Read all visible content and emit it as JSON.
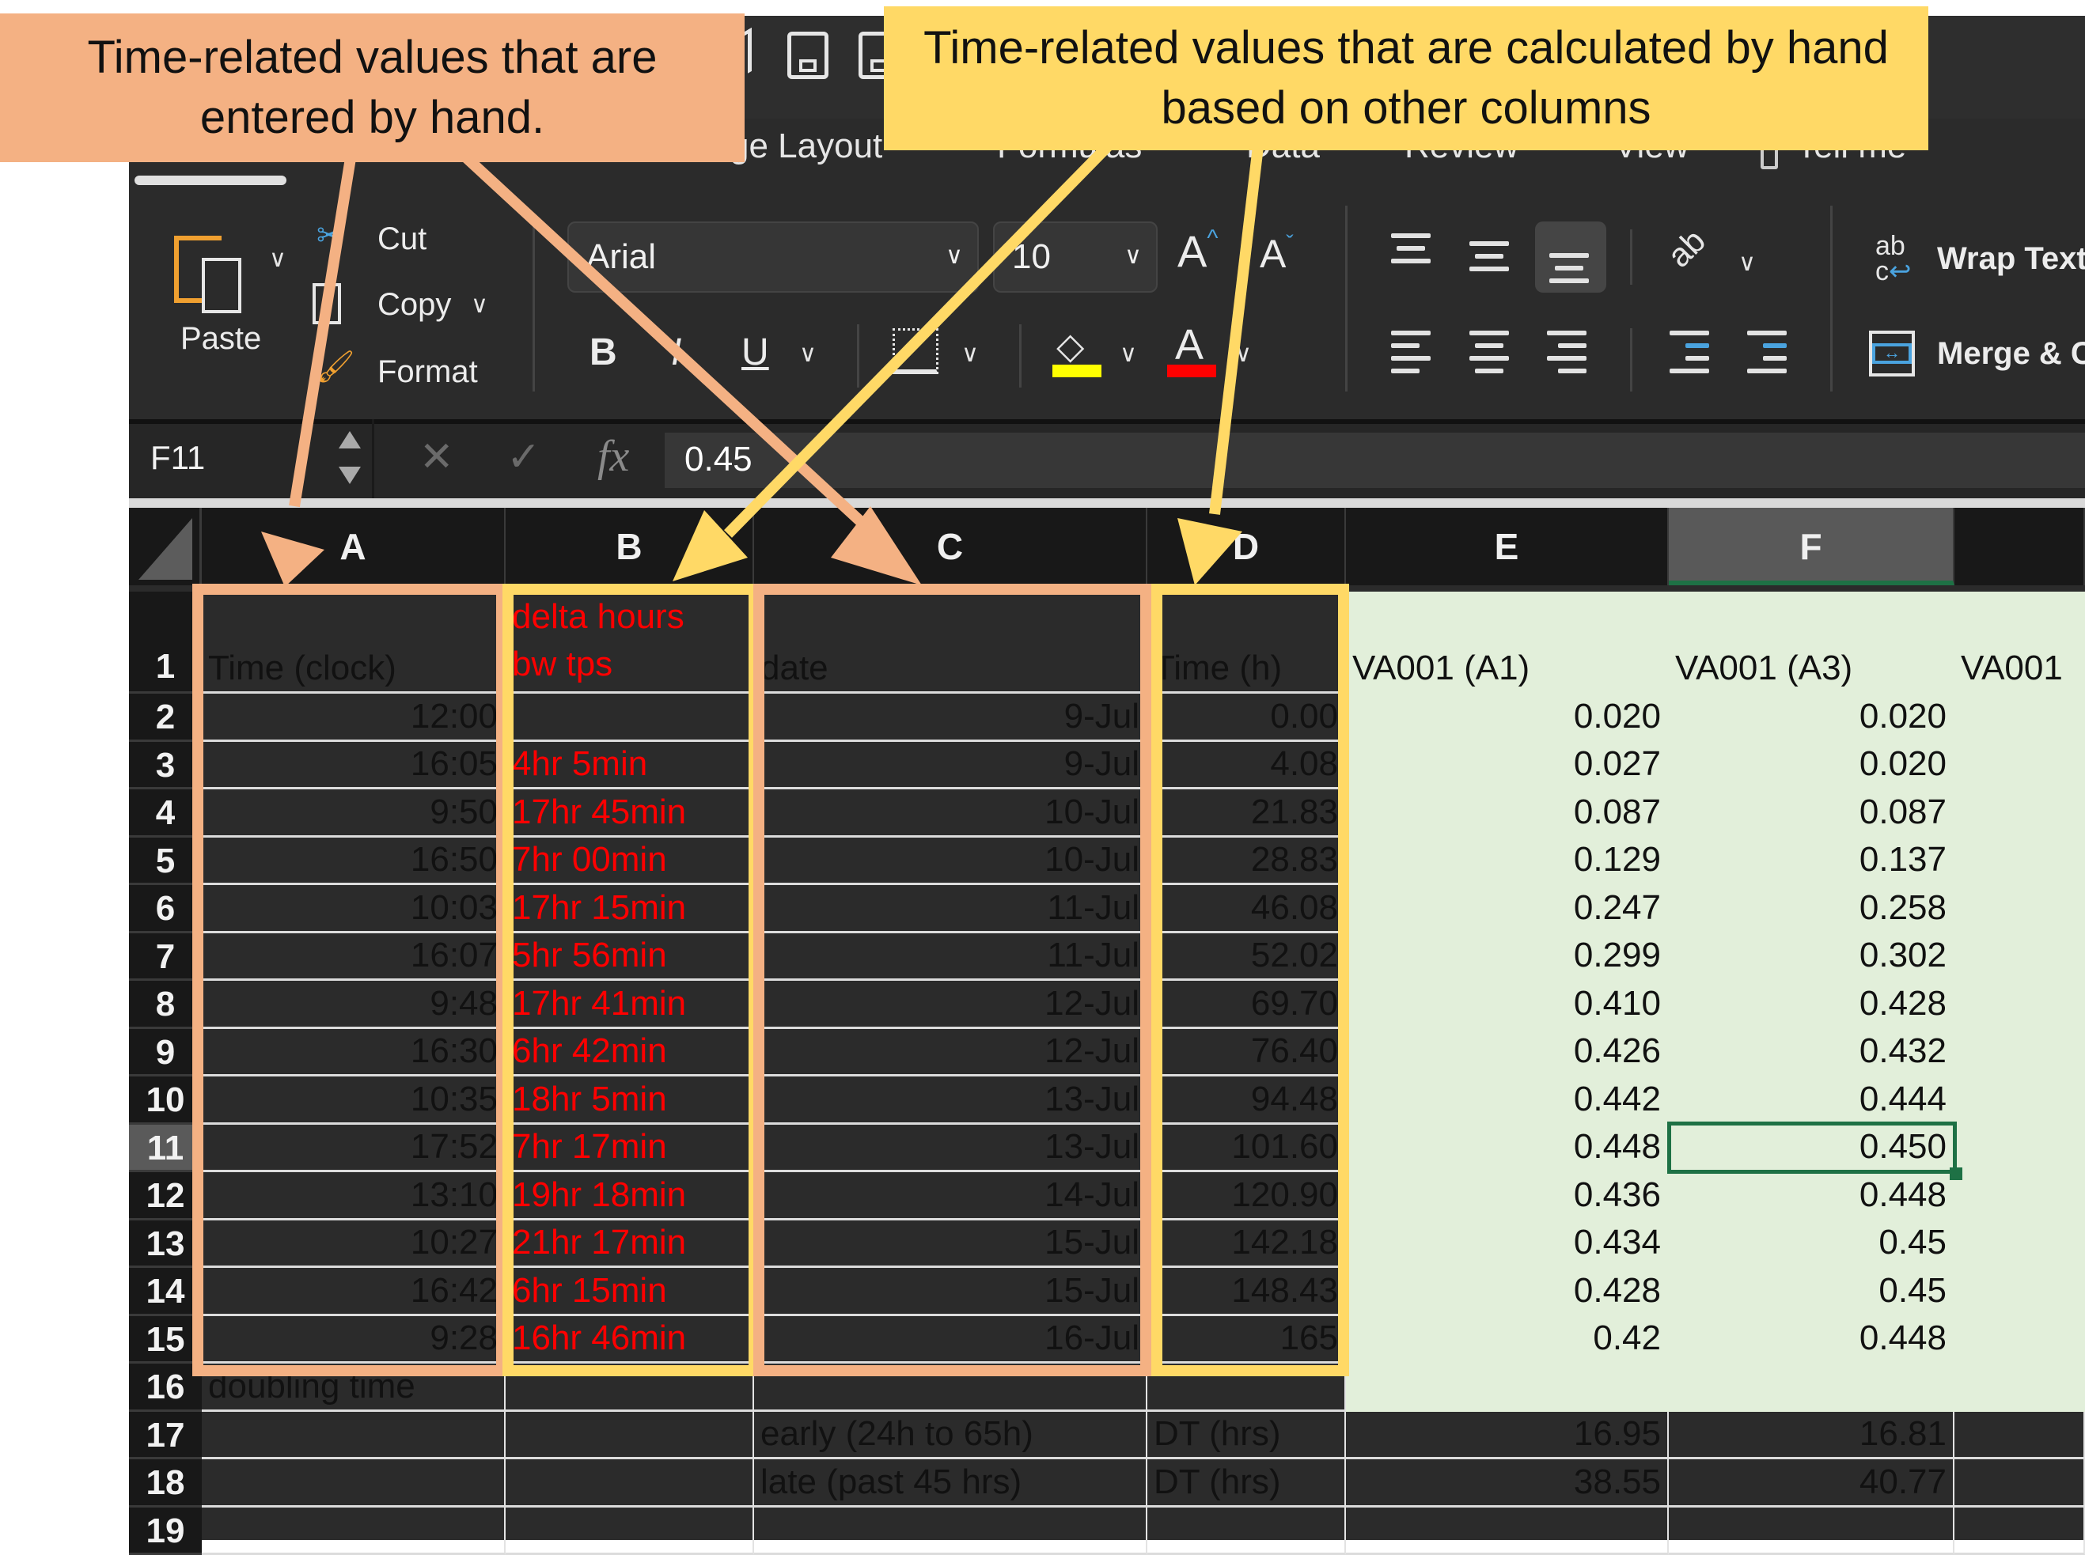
{
  "callouts": {
    "manual": "Time-related values that are entered by hand.",
    "calculated": "Time-related values that are calculated by hand based on other columns"
  },
  "colors": {
    "manual_highlight": "#f4b183",
    "calculated_highlight": "#ffd966",
    "selection": "#1e7145",
    "data_fill": "#e2efda",
    "red_text": "#ff0000"
  },
  "tabs": [
    "ge Layout",
    "Formulas",
    "Data",
    "Review",
    "View",
    "Tell me"
  ],
  "ribbon": {
    "clipboard": {
      "paste": "Paste",
      "cut": "Cut",
      "copy": "Copy",
      "format": "Format"
    },
    "font": {
      "name": "Arial",
      "size": "10",
      "bold": "B",
      "italic": "I",
      "underline": "U",
      "increase": "A",
      "decrease": "A",
      "font_color": "A"
    },
    "wrap_text": "Wrap Text",
    "merge": "Merge & C"
  },
  "formula_bar": {
    "name_box": "F11",
    "fx": "fx",
    "value": "0.45"
  },
  "columns": [
    "A",
    "B",
    "C",
    "D",
    "E",
    "F",
    ""
  ],
  "selected_column": "F",
  "selected_row": "11",
  "rows": [
    {
      "n": "1",
      "A": "Time (clock)",
      "B": "delta hours\nbw tps",
      "C": "date",
      "D": "Time (h)",
      "E": "VA001 (A1)",
      "F": "VA001 (A3)",
      "G": "VA001"
    },
    {
      "n": "2",
      "A": "12:00",
      "B": "",
      "C": "9-Jul",
      "D": "0.00",
      "E": "0.020",
      "F": "0.020"
    },
    {
      "n": "3",
      "A": "16:05",
      "B": "4hr 5min",
      "C": "9-Jul",
      "D": "4.08",
      "E": "0.027",
      "F": "0.020"
    },
    {
      "n": "4",
      "A": "9:50",
      "B": "17hr 45min",
      "C": "10-Jul",
      "D": "21.83",
      "E": "0.087",
      "F": "0.087"
    },
    {
      "n": "5",
      "A": "16:50",
      "B": "7hr 00min",
      "C": "10-Jul",
      "D": "28.83",
      "E": "0.129",
      "F": "0.137"
    },
    {
      "n": "6",
      "A": "10:03",
      "B": "17hr 15min",
      "C": "11-Jul",
      "D": "46.08",
      "E": "0.247",
      "F": "0.258"
    },
    {
      "n": "7",
      "A": "16:07",
      "B": "5hr 56min",
      "C": "11-Jul",
      "D": "52.02",
      "E": "0.299",
      "F": "0.302"
    },
    {
      "n": "8",
      "A": "9:48",
      "B": "17hr 41min",
      "C": "12-Jul",
      "D": "69.70",
      "E": "0.410",
      "F": "0.428"
    },
    {
      "n": "9",
      "A": "16:30",
      "B": "6hr 42min",
      "C": "12-Jul",
      "D": "76.40",
      "E": "0.426",
      "F": "0.432"
    },
    {
      "n": "10",
      "A": "10:35",
      "B": "18hr 5min",
      "C": "13-Jul",
      "D": "94.48",
      "E": "0.442",
      "F": "0.444"
    },
    {
      "n": "11",
      "A": "17:52",
      "B": "7hr 17min",
      "C": "13-Jul",
      "D": "101.60",
      "E": "0.448",
      "F": "0.450"
    },
    {
      "n": "12",
      "A": "13:10",
      "B": "19hr 18min",
      "C": "14-Jul",
      "D": "120.90",
      "E": "0.436",
      "F": "0.448"
    },
    {
      "n": "13",
      "A": "10:27",
      "B": "21hr 17min",
      "C": "15-Jul",
      "D": "142.18",
      "E": "0.434",
      "F": "0.45"
    },
    {
      "n": "14",
      "A": "16:42",
      "B": "6hr 15min",
      "C": "15-Jul",
      "D": "148.43",
      "E": "0.428",
      "F": "0.45"
    },
    {
      "n": "15",
      "A": "9:28",
      "B": "16hr 46min",
      "C": "16-Jul",
      "D": "165",
      "E": "0.42",
      "F": "0.448"
    },
    {
      "n": "16",
      "A": "doubling time",
      "B": "",
      "C": "",
      "D": "",
      "E": "",
      "F": ""
    },
    {
      "n": "17",
      "A": "",
      "B": "",
      "C": "early (24h to 65h)",
      "D": "DT (hrs)",
      "E": "16.95",
      "F": "16.81"
    },
    {
      "n": "18",
      "A": "",
      "B": "",
      "C": "late (past 45 hrs)",
      "D": "DT (hrs)",
      "E": "38.55",
      "F": "40.77"
    },
    {
      "n": "19",
      "A": "",
      "B": "",
      "C": "",
      "D": "",
      "E": "",
      "F": ""
    }
  ]
}
